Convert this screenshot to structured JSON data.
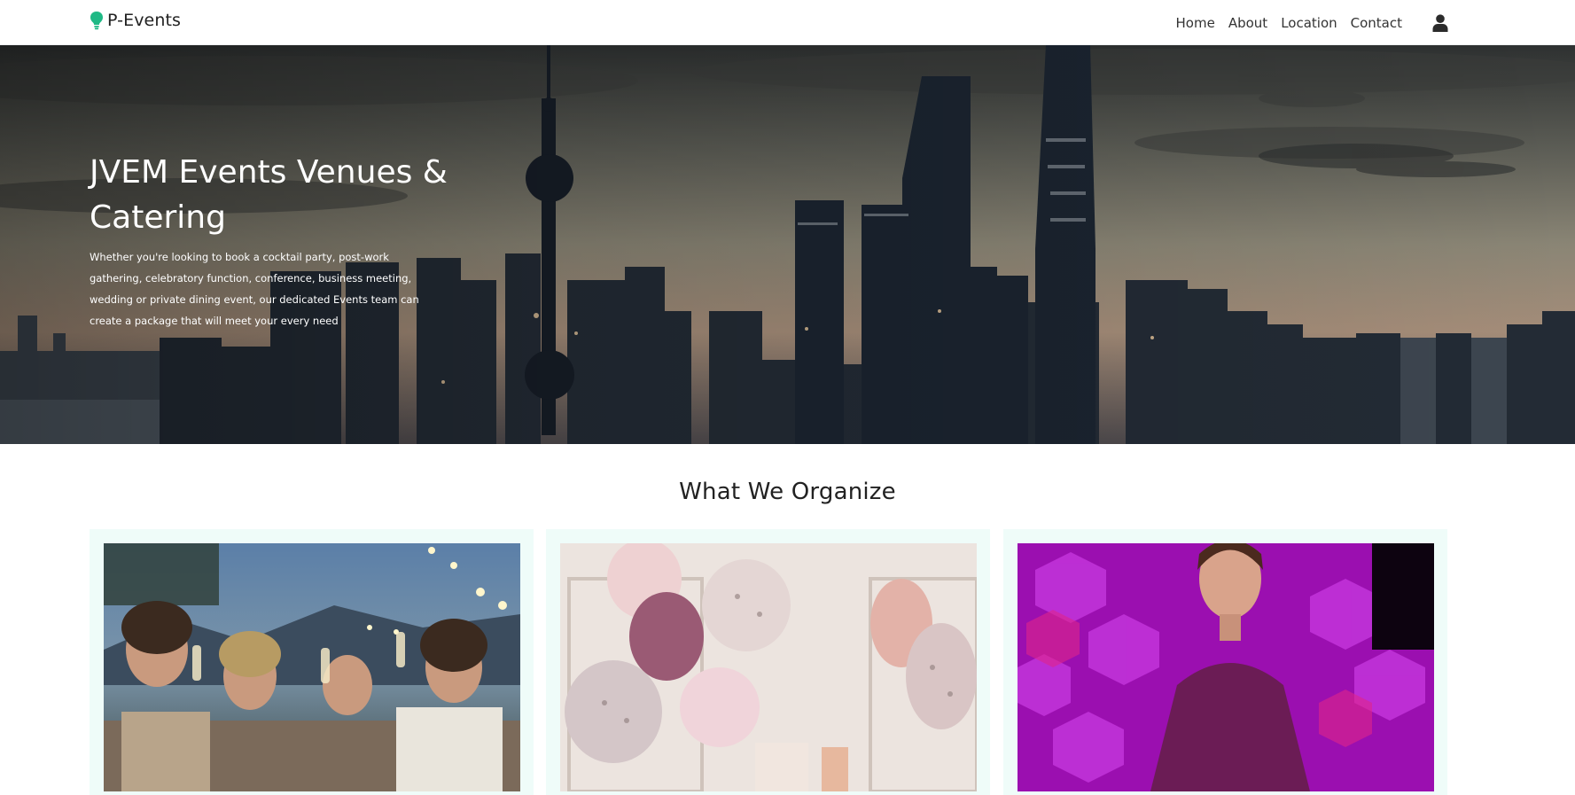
{
  "brand": {
    "name": "P-Events",
    "icon": "lightbulb-icon",
    "color": "#1fb985"
  },
  "nav": {
    "items": [
      {
        "label": "Home"
      },
      {
        "label": "About"
      },
      {
        "label": "Location"
      },
      {
        "label": "Contact"
      }
    ],
    "user_icon": "user-icon"
  },
  "hero": {
    "title": "JVEM Events Venues & Catering",
    "text": "Whether you're looking to book a cocktail party, post-work gathering, celebratory function, conference, business meeting, wedding or private dining event, our dedicated Events team can create a package that will meet your every need"
  },
  "section": {
    "title": "What We Organize",
    "cards": [
      {
        "image": "party-toast-photo"
      },
      {
        "image": "balloons-photo"
      },
      {
        "image": "fashion-show-photo"
      }
    ]
  },
  "colors": {
    "card_bg": "#effcf9",
    "accent": "#1fb985"
  }
}
